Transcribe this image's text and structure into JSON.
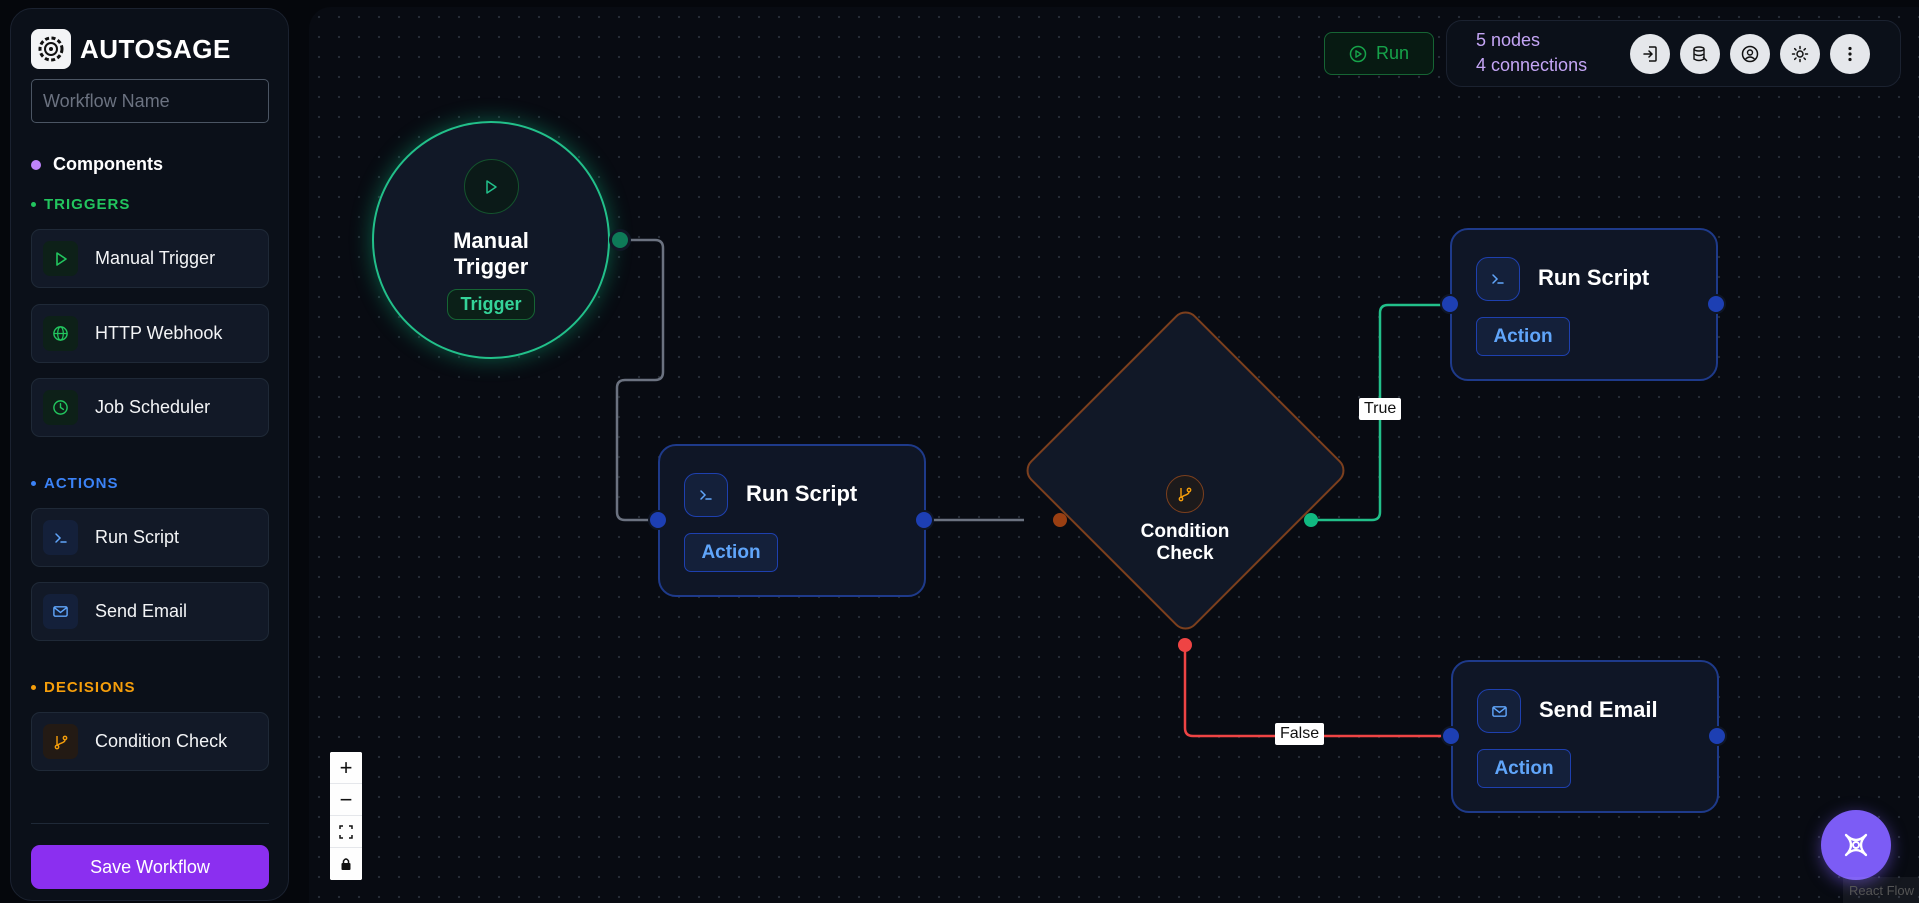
{
  "app": {
    "name": "AUTOSAGE"
  },
  "sidebar": {
    "workflow_name_placeholder": "Workflow Name",
    "components_title": "Components",
    "sections": {
      "triggers": {
        "label": "TRIGGERS",
        "color": "#22c55e",
        "items": [
          {
            "label": "Manual Trigger",
            "icon": "play-icon"
          },
          {
            "label": "HTTP Webhook",
            "icon": "globe-icon"
          },
          {
            "label": "Job Scheduler",
            "icon": "clock-icon"
          }
        ]
      },
      "actions": {
        "label": "ACTIONS",
        "color": "#3b82f6",
        "items": [
          {
            "label": "Run Script",
            "icon": "terminal-icon"
          },
          {
            "label": "Send Email",
            "icon": "mail-icon"
          }
        ]
      },
      "decisions": {
        "label": "DECISIONS",
        "color": "#f59e0b",
        "items": [
          {
            "label": "Condition Check",
            "icon": "git-branch-icon"
          }
        ]
      }
    },
    "save_button": "Save Workflow"
  },
  "toolbar": {
    "run_label": "Run",
    "nodes_count": "5 nodes",
    "connections_count": "4 connections",
    "buttons": [
      "import-icon",
      "database-icon",
      "user-icon",
      "sun-icon",
      "more-vertical-icon"
    ]
  },
  "nodes": {
    "trigger": {
      "title": "Manual Trigger",
      "badge": "Trigger"
    },
    "run_script_1": {
      "title": "Run Script",
      "badge": "Action"
    },
    "condition": {
      "title": "Condition Check"
    },
    "run_script_2": {
      "title": "Run Script",
      "badge": "Action"
    },
    "send_email": {
      "title": "Send Email",
      "badge": "Action"
    }
  },
  "edges": {
    "true_label": "True",
    "false_label": "False"
  },
  "controls": {
    "zoom_in": "+",
    "zoom_out": "−",
    "fit": "⛶",
    "lock": "🔒"
  },
  "attribution": "React Flow",
  "colors": {
    "accent": "#8b2ff0",
    "trigger": "#22c08a",
    "action": "#1e40af",
    "decision": "#d97706",
    "true_edge": "#22c08a",
    "false_edge": "#ef4444"
  }
}
